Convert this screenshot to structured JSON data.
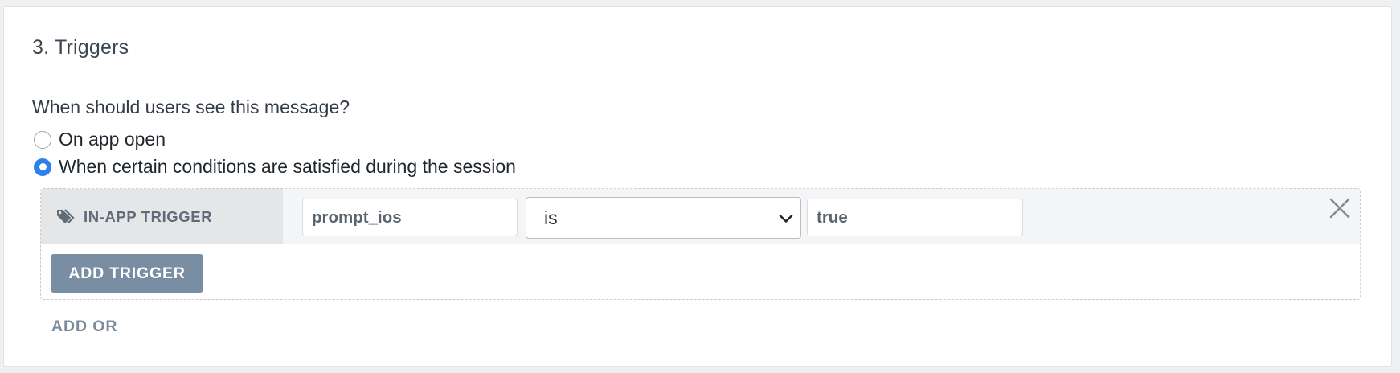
{
  "section": {
    "title": "3. Triggers",
    "question": "When should users see this message?"
  },
  "options": [
    {
      "label": "On app open",
      "selected": false
    },
    {
      "label": "When certain conditions are satisfied during the session",
      "selected": true
    }
  ],
  "trigger": {
    "tag_label": "IN-APP TRIGGER",
    "tag_icon": "tags-icon",
    "name_value": "prompt_ios",
    "operator_value": "is",
    "value": "true",
    "close_icon": "close-icon"
  },
  "buttons": {
    "add_trigger": "ADD TRIGGER",
    "add_or": "ADD OR"
  },
  "colors": {
    "accent": "#2f80e8",
    "button_bg": "#7a8ea3",
    "tag_bg": "#e4e6e8"
  }
}
